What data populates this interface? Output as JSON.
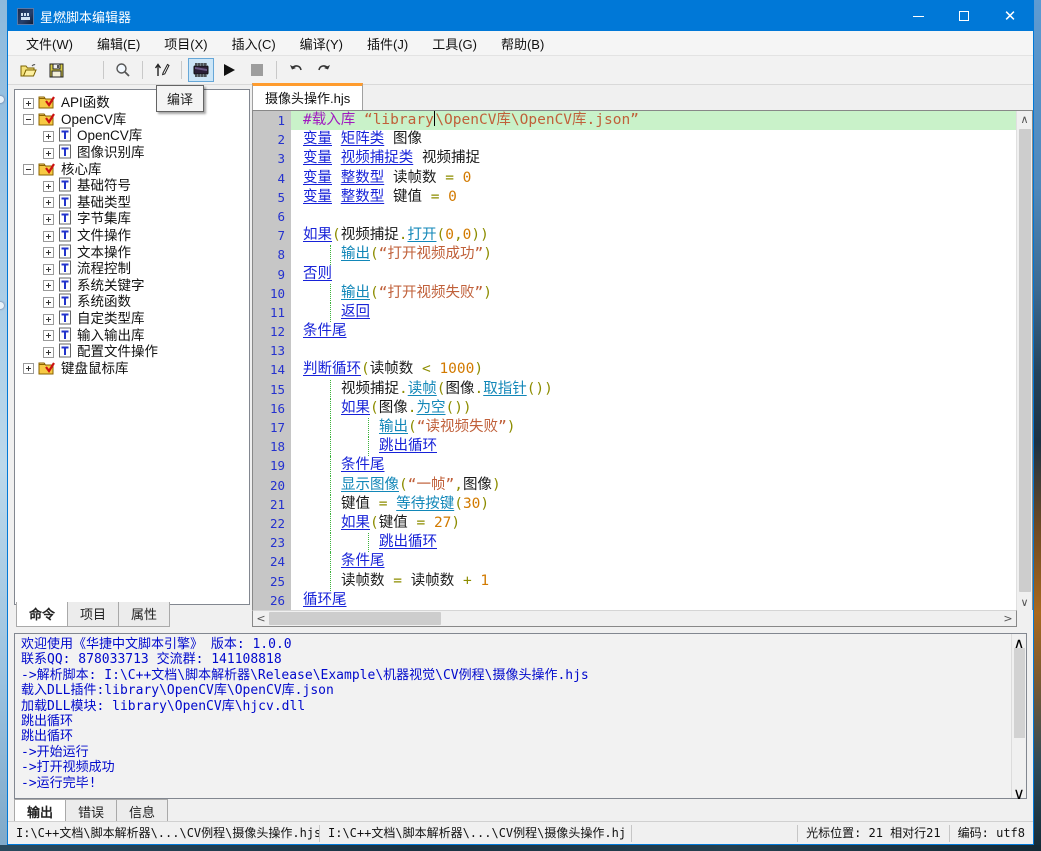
{
  "window": {
    "title": "星燃脚本编辑器"
  },
  "titlebar_buttons": {
    "minimize": "最小化",
    "maximize": "最大化",
    "close": "关闭"
  },
  "menu": {
    "items": [
      {
        "id": "file",
        "label": "文件(W)"
      },
      {
        "id": "edit",
        "label": "编辑(E)"
      },
      {
        "id": "project",
        "label": "项目(X)"
      },
      {
        "id": "insert",
        "label": "插入(C)"
      },
      {
        "id": "compile",
        "label": "编译(Y)"
      },
      {
        "id": "plugin",
        "label": "插件(J)"
      },
      {
        "id": "tools",
        "label": "工具(G)"
      },
      {
        "id": "help",
        "label": "帮助(B)"
      }
    ]
  },
  "toolbar": {
    "tooltip": "编译",
    "buttons": [
      {
        "id": "open",
        "icon": "folder-open-icon"
      },
      {
        "id": "save",
        "icon": "save-icon"
      },
      {
        "id": "save-all",
        "icon": "save-all-icon"
      },
      {
        "id": "sep1",
        "icon": "separator"
      },
      {
        "id": "search",
        "icon": "search-icon"
      },
      {
        "id": "sep2",
        "icon": "separator"
      },
      {
        "id": "goto",
        "icon": "pen-arrow-icon"
      },
      {
        "id": "sep3",
        "icon": "separator"
      },
      {
        "id": "compile",
        "icon": "chip-icon",
        "active": true
      },
      {
        "id": "run",
        "icon": "play-icon"
      },
      {
        "id": "stop",
        "icon": "stop-icon",
        "disabled": true
      },
      {
        "id": "sep4",
        "icon": "separator"
      },
      {
        "id": "undo",
        "icon": "undo-icon"
      },
      {
        "id": "redo",
        "icon": "redo-icon"
      }
    ]
  },
  "sidebar": {
    "tree": [
      {
        "label": "API函数",
        "level": 0,
        "exp": "plus",
        "icon": "folder-check-icon"
      },
      {
        "label": "OpenCV库",
        "level": 0,
        "exp": "minus",
        "icon": "folder-check-icon"
      },
      {
        "label": "OpenCV库",
        "level": 1,
        "exp": "plus",
        "icon": "doc-t-icon"
      },
      {
        "label": "图像识别库",
        "level": 1,
        "exp": "plus",
        "icon": "doc-t-icon"
      },
      {
        "label": "核心库",
        "level": 0,
        "exp": "minus",
        "icon": "folder-check-icon"
      },
      {
        "label": "基础符号",
        "level": 1,
        "exp": "plus",
        "icon": "doc-t-icon"
      },
      {
        "label": "基础类型",
        "level": 1,
        "exp": "plus",
        "icon": "doc-t-icon"
      },
      {
        "label": "字节集库",
        "level": 1,
        "exp": "plus",
        "icon": "doc-t-icon"
      },
      {
        "label": "文件操作",
        "level": 1,
        "exp": "plus",
        "icon": "doc-t-icon"
      },
      {
        "label": "文本操作",
        "level": 1,
        "exp": "plus",
        "icon": "doc-t-icon"
      },
      {
        "label": "流程控制",
        "level": 1,
        "exp": "plus",
        "icon": "doc-t-icon"
      },
      {
        "label": "系统关键字",
        "level": 1,
        "exp": "plus",
        "icon": "doc-t-icon"
      },
      {
        "label": "系统函数",
        "level": 1,
        "exp": "plus",
        "icon": "doc-t-icon"
      },
      {
        "label": "自定类型库",
        "level": 1,
        "exp": "plus",
        "icon": "doc-t-icon"
      },
      {
        "label": "输入输出库",
        "level": 1,
        "exp": "plus",
        "icon": "doc-t-icon"
      },
      {
        "label": "配置文件操作",
        "level": 1,
        "exp": "plus",
        "icon": "doc-t-icon"
      },
      {
        "label": "键盘鼠标库",
        "level": 0,
        "exp": "plus",
        "icon": "folder-check-icon"
      }
    ],
    "tabs": [
      {
        "id": "command",
        "label": "命令",
        "active": true
      },
      {
        "id": "project",
        "label": "项目",
        "active": false
      },
      {
        "id": "property",
        "label": "属性",
        "active": false
      }
    ]
  },
  "editor": {
    "tab": "摄像头操作.hjs",
    "lines": [
      {
        "n": 1,
        "indent": 0,
        "current": true,
        "tokens": [
          [
            "dir",
            "#载入库"
          ],
          [
            "pl",
            " "
          ],
          [
            "str",
            "“library"
          ],
          [
            "caret",
            ""
          ],
          [
            "str",
            "\\OpenCV库\\OpenCV库.json”"
          ]
        ]
      },
      {
        "n": 2,
        "indent": 0,
        "tokens": [
          [
            "kw",
            "变量"
          ],
          [
            "pl",
            " "
          ],
          [
            "kw",
            "矩阵类"
          ],
          [
            "pl",
            " "
          ],
          [
            "id",
            "图像"
          ]
        ]
      },
      {
        "n": 3,
        "indent": 0,
        "tokens": [
          [
            "kw",
            "变量"
          ],
          [
            "pl",
            " "
          ],
          [
            "kw",
            "视频捕捉类"
          ],
          [
            "pl",
            " "
          ],
          [
            "id",
            "视频捕捉"
          ]
        ]
      },
      {
        "n": 4,
        "indent": 0,
        "tokens": [
          [
            "kw",
            "变量"
          ],
          [
            "pl",
            " "
          ],
          [
            "kw",
            "整数型"
          ],
          [
            "pl",
            " "
          ],
          [
            "id",
            "读帧数"
          ],
          [
            "pl",
            " "
          ],
          [
            "op",
            "="
          ],
          [
            "pl",
            " "
          ],
          [
            "num",
            "0"
          ]
        ]
      },
      {
        "n": 5,
        "indent": 0,
        "tokens": [
          [
            "kw",
            "变量"
          ],
          [
            "pl",
            " "
          ],
          [
            "kw",
            "整数型"
          ],
          [
            "pl",
            " "
          ],
          [
            "id",
            "键值"
          ],
          [
            "pl",
            " "
          ],
          [
            "op",
            "="
          ],
          [
            "pl",
            " "
          ],
          [
            "num",
            "0"
          ]
        ]
      },
      {
        "n": 6,
        "indent": 0,
        "tokens": []
      },
      {
        "n": 7,
        "indent": 0,
        "tokens": [
          [
            "kw",
            "如果"
          ],
          [
            "op",
            "("
          ],
          [
            "id",
            "视频捕捉"
          ],
          [
            "op",
            "."
          ],
          [
            "fn",
            "打开"
          ],
          [
            "op",
            "("
          ],
          [
            "num",
            "0"
          ],
          [
            "op",
            ","
          ],
          [
            "num",
            "0"
          ],
          [
            "op",
            "))"
          ]
        ]
      },
      {
        "n": 8,
        "indent": 1,
        "tokens": [
          [
            "fn",
            "输出"
          ],
          [
            "op",
            "("
          ],
          [
            "str",
            "“打开视频成功”"
          ],
          [
            "op",
            ")"
          ]
        ]
      },
      {
        "n": 9,
        "indent": 0,
        "tokens": [
          [
            "kw",
            "否则"
          ]
        ]
      },
      {
        "n": 10,
        "indent": 1,
        "tokens": [
          [
            "fn",
            "输出"
          ],
          [
            "op",
            "("
          ],
          [
            "str",
            "“打开视频失败”"
          ],
          [
            "op",
            ")"
          ]
        ]
      },
      {
        "n": 11,
        "indent": 1,
        "tokens": [
          [
            "kw",
            "返回"
          ]
        ]
      },
      {
        "n": 12,
        "indent": 0,
        "tokens": [
          [
            "kw",
            "条件尾"
          ]
        ]
      },
      {
        "n": 13,
        "indent": 0,
        "tokens": []
      },
      {
        "n": 14,
        "indent": 0,
        "tokens": [
          [
            "kw",
            "判断循环"
          ],
          [
            "op",
            "("
          ],
          [
            "id",
            "读帧数"
          ],
          [
            "pl",
            " "
          ],
          [
            "op",
            "<"
          ],
          [
            "pl",
            " "
          ],
          [
            "num",
            "1000"
          ],
          [
            "op",
            ")"
          ]
        ]
      },
      {
        "n": 15,
        "indent": 1,
        "tokens": [
          [
            "id",
            "视频捕捉"
          ],
          [
            "op",
            "."
          ],
          [
            "fn",
            "读帧"
          ],
          [
            "op",
            "("
          ],
          [
            "id",
            "图像"
          ],
          [
            "op",
            "."
          ],
          [
            "fn",
            "取指针"
          ],
          [
            "op",
            "())"
          ]
        ]
      },
      {
        "n": 16,
        "indent": 1,
        "tokens": [
          [
            "kw",
            "如果"
          ],
          [
            "op",
            "("
          ],
          [
            "id",
            "图像"
          ],
          [
            "op",
            "."
          ],
          [
            "fn",
            "为空"
          ],
          [
            "op",
            "())"
          ]
        ]
      },
      {
        "n": 17,
        "indent": 2,
        "tokens": [
          [
            "fn",
            "输出"
          ],
          [
            "op",
            "("
          ],
          [
            "str",
            "“读视频失败”"
          ],
          [
            "op",
            ")"
          ]
        ]
      },
      {
        "n": 18,
        "indent": 2,
        "tokens": [
          [
            "kw",
            "跳出循环"
          ]
        ]
      },
      {
        "n": 19,
        "indent": 1,
        "tokens": [
          [
            "kw",
            "条件尾"
          ]
        ]
      },
      {
        "n": 20,
        "indent": 1,
        "tokens": [
          [
            "fn",
            "显示图像"
          ],
          [
            "op",
            "("
          ],
          [
            "str",
            "“一帧”"
          ],
          [
            "op",
            ","
          ],
          [
            "id",
            "图像"
          ],
          [
            "op",
            ")"
          ]
        ]
      },
      {
        "n": 21,
        "indent": 1,
        "tokens": [
          [
            "id",
            "键值"
          ],
          [
            "pl",
            " "
          ],
          [
            "op",
            "="
          ],
          [
            "pl",
            " "
          ],
          [
            "fn",
            "等待按键"
          ],
          [
            "op",
            "("
          ],
          [
            "num",
            "30"
          ],
          [
            "op",
            ")"
          ]
        ]
      },
      {
        "n": 22,
        "indent": 1,
        "tokens": [
          [
            "kw",
            "如果"
          ],
          [
            "op",
            "("
          ],
          [
            "id",
            "键值"
          ],
          [
            "pl",
            " "
          ],
          [
            "op",
            "="
          ],
          [
            "pl",
            " "
          ],
          [
            "num",
            "27"
          ],
          [
            "op",
            ")"
          ]
        ]
      },
      {
        "n": 23,
        "indent": 2,
        "tokens": [
          [
            "kw",
            "跳出循环"
          ]
        ]
      },
      {
        "n": 24,
        "indent": 1,
        "tokens": [
          [
            "kw",
            "条件尾"
          ]
        ]
      },
      {
        "n": 25,
        "indent": 1,
        "tokens": [
          [
            "id",
            "读帧数"
          ],
          [
            "pl",
            " "
          ],
          [
            "op",
            "="
          ],
          [
            "pl",
            " "
          ],
          [
            "id",
            "读帧数"
          ],
          [
            "pl",
            " "
          ],
          [
            "op",
            "+"
          ],
          [
            "pl",
            " "
          ],
          [
            "num",
            "1"
          ]
        ]
      },
      {
        "n": 26,
        "indent": 0,
        "tokens": [
          [
            "kw",
            "循环尾"
          ]
        ]
      }
    ]
  },
  "output": {
    "lines": [
      "欢迎使用《华捷中文脚本引擎》 版本: 1.0.0",
      "联系QQ: 878033713 交流群: 141108818",
      "->解析脚本: I:\\C++文档\\脚本解析器\\Release\\Example\\机器视觉\\CV例程\\摄像头操作.hjs",
      "载入DLL插件:library\\OpenCV库\\OpenCV库.json",
      "加载DLL模块: library\\OpenCV库\\hjcv.dll",
      "跳出循环",
      "跳出循环",
      "->开始运行",
      "->打开视频成功",
      "->运行完毕!"
    ],
    "tabs": [
      {
        "id": "output",
        "label": "输出",
        "active": true
      },
      {
        "id": "error",
        "label": "错误",
        "active": false
      },
      {
        "id": "info",
        "label": "信息",
        "active": false
      }
    ]
  },
  "statusbar": {
    "path1": "I:\\C++文档\\脚本解析器\\...\\CV例程\\摄像头操作.hjs",
    "path2": "I:\\C++文档\\脚本解析器\\...\\CV例程\\摄像头操作.hj",
    "cursor": "光标位置: 21 相对行21",
    "encoding": "编码: utf8"
  },
  "colors": {
    "titlebar": "#0078d7",
    "current_line_bg": "#c9f2c9",
    "keyword": "#1722d8",
    "function": "#1287b8",
    "string": "#c0603a",
    "number": "#d27a00",
    "operator": "#8d8d00",
    "directive": "#a019c0",
    "line_number": "#2431cf",
    "output_text": "#0009cc",
    "tab_accent": "#ff9c2e"
  }
}
